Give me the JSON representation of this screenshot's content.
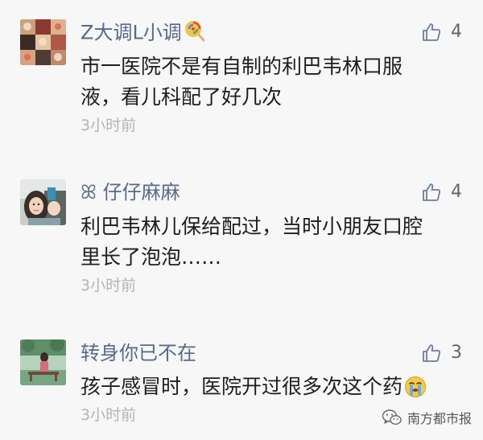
{
  "comments": [
    {
      "nickname": "Z大调L小调",
      "nickname_emoji": "lollipop-emoji",
      "likes": "4",
      "lines": [
        "市一医院不是有自制的利巴韦林口服",
        "液，看儿科配了好几次"
      ],
      "time": "3小时前"
    },
    {
      "nickname": "ꕤ 仔仔麻麻",
      "likes": "4",
      "lines": [
        "利巴韦林儿保给配过，当时小朋友口腔",
        "里长了泡泡……"
      ],
      "time": "3小时前"
    },
    {
      "nickname": "转身你已不在",
      "likes": "3",
      "lines": [
        "孩子感冒时，医院开过很多次这个药"
      ],
      "content_emoji": "crying-face-emoji",
      "time": "3小时前"
    }
  ],
  "watermark": {
    "text": "南方都市报",
    "icon": "wechat-icon"
  },
  "colors": {
    "nickname": "#586a8a",
    "content": "#1e1e1e",
    "time": "#b4b4b4",
    "like_icon": "#6b7d99",
    "background": "#f7f7f7"
  }
}
